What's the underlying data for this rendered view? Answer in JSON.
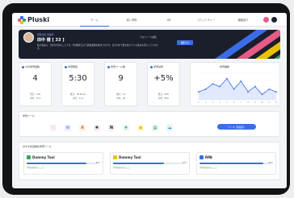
{
  "app": {
    "name": "Pluski"
  },
  "nav": {
    "items": [
      "ホーム",
      "導入事例",
      "DB",
      "コミュニティー",
      "機能紹介"
    ]
  },
  "profile": {
    "subtitle": "関東支店 営業部",
    "name": "田中 健 [ 33 ]",
    "message": "私の強みは、分析力があることです。世界観を広げて顧客課題を解決できます。自分の中で磨き続けている強みを活かしていきます。",
    "edit_text": "プロフィール編集",
    "action_label": "編集する"
  },
  "stats": [
    {
      "title": "今月学習回数",
      "value": "4",
      "sub1": "累計：248",
      "sub2": "平均：12.2"
    },
    {
      "title": "学習時間",
      "value": "5:30",
      "sub1": "累計：38:50:22",
      "sub2": "平均：2:11"
    },
    {
      "title": "学習ツール数",
      "value": "9",
      "sub1": "累計：24",
      "sub2": "平均：38"
    },
    {
      "title": "学習効率",
      "value": "+5%",
      "sub1": "累計：68%",
      "sub2": "平均：89%"
    }
  ],
  "chart": {
    "title": "学習推移",
    "chart_data": {
      "type": "area",
      "x": [
        "1",
        "2",
        "3",
        "4",
        "5",
        "6",
        "7",
        "8",
        "9",
        "10",
        "11",
        "12"
      ],
      "series": [
        {
          "values": [
            3,
            4,
            6,
            5,
            8,
            4,
            7,
            3,
            5,
            2,
            4,
            3
          ]
        }
      ],
      "ylim": [
        0,
        10
      ],
      "color": "#3a6ee8"
    }
  },
  "tools": {
    "title": "学習ツール",
    "add_label": "ツール一覧画面へ",
    "items": [
      {
        "icon": "heart-icon",
        "glyph": "♡",
        "color": "#e85a87",
        "bg": "#fdeef3"
      },
      {
        "icon": "gear-icon",
        "glyph": "⚙",
        "color": "#3a6ee8",
        "bg": "#e8eefc"
      },
      {
        "icon": "a-letter-icon",
        "glyph": "A",
        "color": "#e86a2b",
        "bg": "#fff1e6"
      },
      {
        "icon": "slack-icon",
        "glyph": "✱",
        "color": "#4a154b",
        "bg": "#f4ecf4"
      },
      {
        "icon": "notion-icon",
        "glyph": "N",
        "color": "#222222",
        "bg": "#f0f0f0"
      },
      {
        "icon": "puzzle-icon",
        "glyph": "✚",
        "color": "#3ba55d",
        "bg": "#eaf7ee"
      },
      {
        "icon": "mailchimp-icon",
        "glyph": "●",
        "color": "#e8c200",
        "bg": "#fff8d6"
      },
      {
        "icon": "sheets-icon",
        "glyph": "▤",
        "color": "#1e9e4a",
        "bg": "#e6f6ec"
      },
      {
        "icon": "salesforce-icon",
        "glyph": "☁",
        "color": "#1f9ad6",
        "bg": "#e6f3fb"
      }
    ]
  },
  "recommendations": {
    "title": "おすすめ自動化学習ツール",
    "items": [
      {
        "name": "Dummy Tool",
        "icon_color": "#3ba55d",
        "progress": 0.84,
        "percent": "84%",
        "desc": "学習を始めましょう"
      },
      {
        "name": "Dummy Tool",
        "icon_color": "#e8c200",
        "progress": 0.72,
        "percent": "72%",
        "desc": "学習を始めましょう"
      },
      {
        "name": "RPA",
        "icon_color": "#3a6ee8",
        "progress": 0.9,
        "percent": "90%",
        "desc": "学習を始めましょう"
      }
    ]
  }
}
